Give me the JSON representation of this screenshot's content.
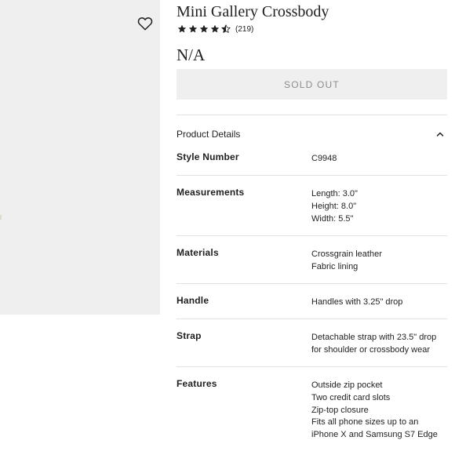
{
  "product": {
    "title": "Mini Gallery Crossbody",
    "rating": 4.5,
    "review_count": "(219)",
    "price": "N/A",
    "button_label": "SOLD OUT"
  },
  "icons": {
    "favorite": "heart-icon",
    "star": "star-icon",
    "collapse": "chevron-up-icon"
  },
  "details": {
    "heading": "Product Details",
    "rows": [
      {
        "label": "Style Number",
        "values": [
          "C9948"
        ]
      },
      {
        "label": "Measurements",
        "values": [
          "Length: 3.0\"",
          "Height: 8.0\"",
          "Width: 5.5\""
        ]
      },
      {
        "label": "Materials",
        "values": [
          "Crossgrain leather",
          "Fabric lining"
        ]
      },
      {
        "label": "Handle",
        "values": [
          "Handles with 3.25\" drop"
        ]
      },
      {
        "label": "Strap",
        "values": [
          "Detachable strap with 23.5\" drop",
          "for shoulder or crossbody wear"
        ]
      },
      {
        "label": "Features",
        "values": [
          "Outside zip pocket",
          "Two credit card slots",
          "Zip-top closure",
          "Fits all phone sizes up to an",
          "iPhone X and Samsung S7 Edge"
        ]
      }
    ]
  },
  "colors": {
    "image_bg": "#efefef",
    "button_bg": "#efefef",
    "button_text": "#8c8c8c",
    "divider": "#e2e2e2"
  }
}
